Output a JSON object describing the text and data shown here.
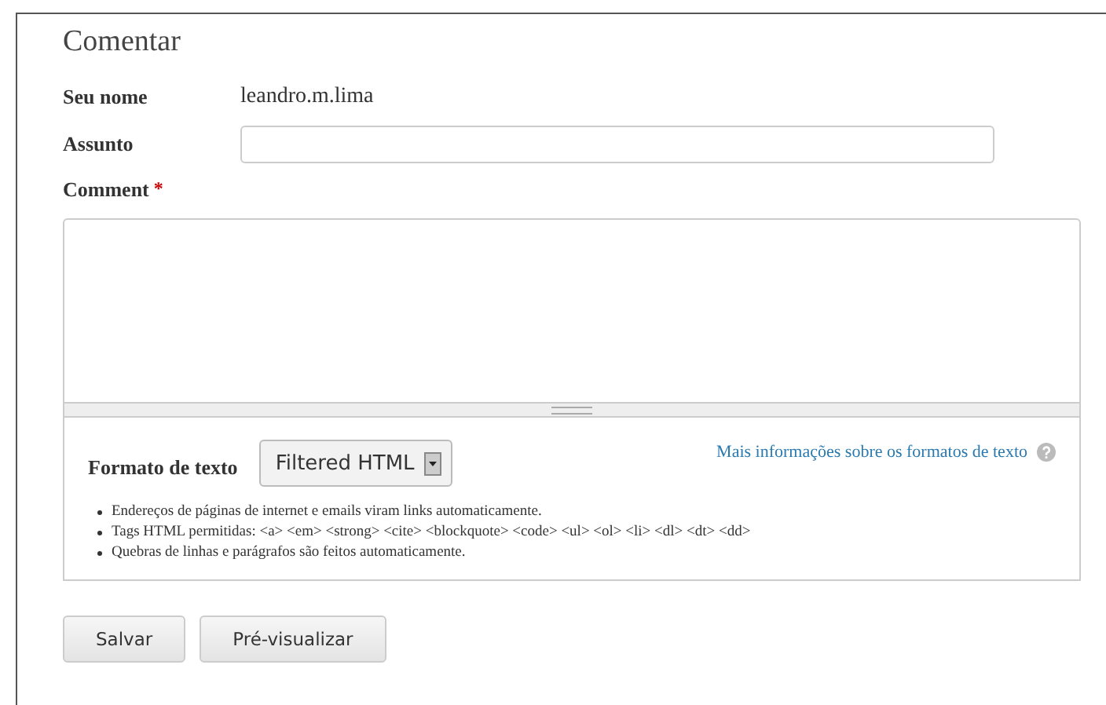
{
  "title": "Comentar",
  "name_field": {
    "label": "Seu nome",
    "value": "leandro.m.lima"
  },
  "subject_field": {
    "label": "Assunto"
  },
  "comment_field": {
    "label": "Comment",
    "required_mark": "*"
  },
  "text_format": {
    "label": "Formato de texto",
    "selected": "Filtered HTML",
    "help_link": "Mais informações sobre os formatos de texto",
    "tips": [
      "Endereços de páginas de internet e emails viram links automaticamente.",
      "Tags HTML permitidas: <a> <em> <strong> <cite> <blockquote> <code> <ul> <ol> <li> <dl> <dt> <dd>",
      "Quebras de linhas e parágrafos são feitos automaticamente."
    ]
  },
  "buttons": [
    "Salvar",
    "Pré-visualizar"
  ]
}
